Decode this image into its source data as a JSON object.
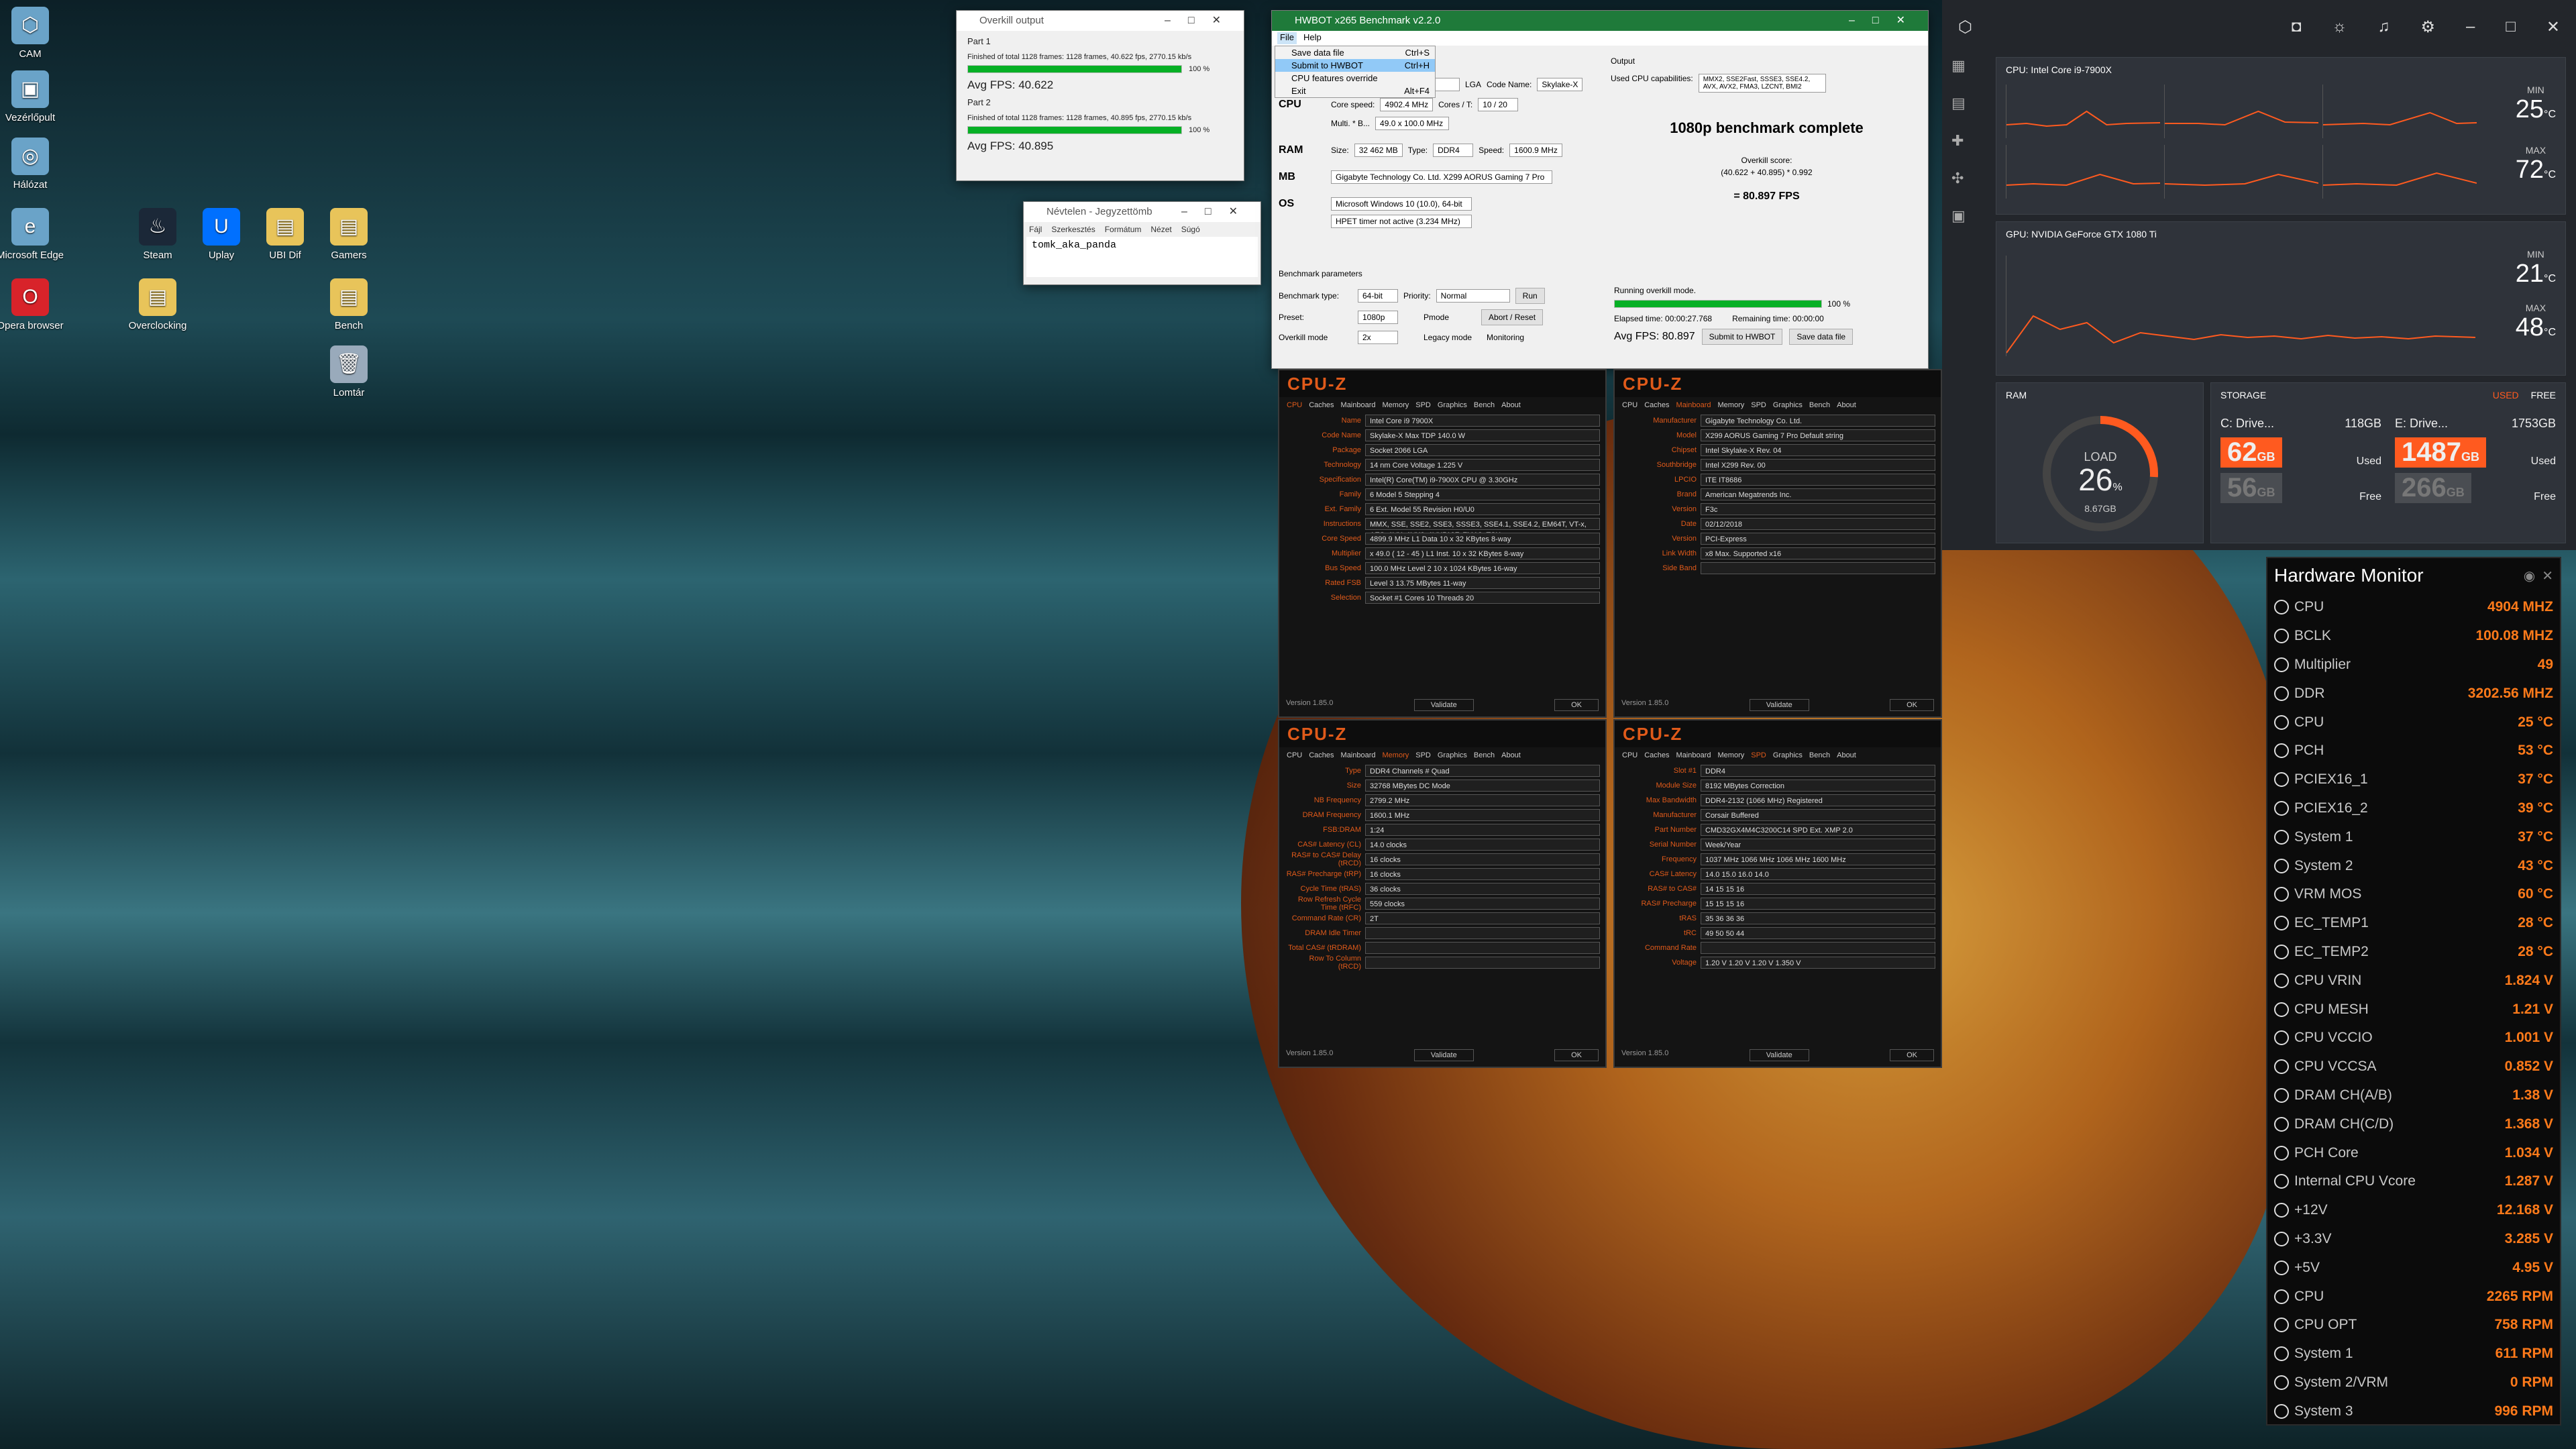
{
  "desktop": {
    "icons": [
      {
        "label": "CAM",
        "glyph": "⬡"
      },
      {
        "label": "Vezérlőpult",
        "glyph": "▣"
      },
      {
        "label": "Hálózat",
        "glyph": "◎"
      },
      {
        "label": "Microsoft Edge",
        "glyph": "e"
      },
      {
        "label": "Opera browser",
        "glyph": "O"
      },
      {
        "label": "Steam",
        "glyph": "♨"
      },
      {
        "label": "Uplay",
        "glyph": "U"
      },
      {
        "label": "UBI Dif",
        "glyph": "▤"
      },
      {
        "label": "Gamers",
        "glyph": "▤"
      },
      {
        "label": "Overclocking",
        "glyph": "▤"
      },
      {
        "label": "Bench",
        "glyph": "▤"
      },
      {
        "label": "Lomtár",
        "glyph": "🗑"
      }
    ]
  },
  "overkill": {
    "title": "Overkill output",
    "part1": "Part 1",
    "line1": "Finished of total 1128 frames: 1128 frames, 40.622 fps,  2770.15 kb/s",
    "pct1": "100 %",
    "avg1": "Avg FPS: 40.622",
    "part2": "Part 2",
    "line2": "Finished of total 1128 frames: 1128 frames, 40.895 fps,  2770.15 kb/s",
    "pct2": "100 %",
    "avg2": "Avg FPS: 40.895",
    "progress": 1.0
  },
  "notepad": {
    "title": "Névtelen - Jegyzettömb",
    "menu": [
      "Fájl",
      "Szerkesztés",
      "Formátum",
      "Nézet",
      "Súgó"
    ],
    "text": "tomk_aka_panda"
  },
  "hwbot": {
    "title": "HWBOT x265 Benchmark v2.2.0",
    "menu": [
      "File",
      "Help"
    ],
    "filemenu": [
      {
        "label": "Save data file",
        "key": "Ctrl+S"
      },
      {
        "label": "Submit to HWBOT",
        "key": "Ctrl+H"
      },
      {
        "label": "CPU features override",
        "key": ""
      },
      {
        "label": "Exit",
        "key": "Alt+F4"
      }
    ],
    "cpu_name": "e i9-7900X",
    "socket": "LGA",
    "code_name_label": "Code Name:",
    "code_name": "Skylake-X",
    "cpu_label": "CPU",
    "core_speed_label": "Core speed:",
    "core_speed": "4902.4 MHz",
    "cores_label": "Cores / T:",
    "cores": "10 / 20",
    "multi_label": "Multi. * B...",
    "multi": "49.0 x 100.0 MHz",
    "ram_label": "RAM",
    "size_label": "Size:",
    "size": "32 462 MB",
    "type_label": "Type:",
    "type": "DDR4",
    "speed_label": "Speed:",
    "speed": "1600.9 MHz",
    "mb_label": "MB",
    "mb": "Gigabyte Technology Co. Ltd. X299 AORUS Gaming 7 Pro",
    "os_label": "OS",
    "os": "Microsoft Windows 10 (10.0), 64-bit",
    "hpet": "HPET timer not active (3.234 MHz)",
    "output_label": "Output",
    "cpu_caps_label": "Used CPU capabilities:",
    "cpu_caps": "MMX2, SSE2Fast, SSSE3, SSE4.2, AVX, AVX2, FMA3, LZCNT, BMI2",
    "complete": "1080p benchmark complete",
    "score_label": "Overkill score:",
    "score_formula": "(40.622 + 40.895) * 0.992",
    "score": "= 80.897 FPS",
    "params_label": "Benchmark parameters",
    "bench_type_label": "Benchmark type:",
    "bench_type": "64-bit",
    "priority_label": "Priority:",
    "priority": "Normal",
    "run": "Run",
    "preset_label": "Preset:",
    "preset": "1080p",
    "pmode": "Pmode",
    "abort": "Abort / Reset",
    "overkill_label": "Overkill mode",
    "overkill_val": "2x",
    "legacy": "Legacy mode",
    "monitoring": "Monitoring",
    "running": "Running overkill mode.",
    "run_pct": "100 %",
    "elapsed": "Elapsed time: 00:00:27.768",
    "remaining": "Remaining time: 00:00:00",
    "avg": "Avg FPS: 80.897",
    "submit": "Submit to HWBOT",
    "save": "Save data file",
    "progress": 1.0
  },
  "cpuz": [
    {
      "active": "CPU",
      "rows": [
        [
          "Name",
          "Intel Core i9 7900X"
        ],
        [
          "Code Name",
          "Skylake-X   Max TDP 140.0 W"
        ],
        [
          "Package",
          "Socket 2066 LGA"
        ],
        [
          "Technology",
          "14 nm   Core Voltage 1.225 V"
        ],
        [
          "Specification",
          "Intel(R) Core(TM) i9-7900X CPU @ 3.30GHz"
        ],
        [
          "Family",
          "6   Model 5   Stepping 4"
        ],
        [
          "Ext. Family",
          "6   Ext. Model 55   Revision H0/U0"
        ],
        [
          "Instructions",
          "MMX, SSE, SSE2, SSE3, SSSE3, SSE4.1, SSE4.2, EM64T, VT-x, AES, AVX, AVX2, AVX512F, FMA3, TSX"
        ],
        [
          "Core Speed",
          "4899.9 MHz   L1 Data 10 x 32 KBytes 8-way"
        ],
        [
          "Multiplier",
          "x 49.0 ( 12 - 45 )   L1 Inst. 10 x 32 KBytes 8-way"
        ],
        [
          "Bus Speed",
          "100.0 MHz   Level 2 10 x 1024 KBytes 16-way"
        ],
        [
          "Rated FSB",
          "Level 3 13.75 MBytes 11-way"
        ],
        [
          "Selection",
          "Socket #1   Cores 10   Threads 20"
        ]
      ]
    },
    {
      "active": "Mainboard",
      "rows": [
        [
          "Manufacturer",
          "Gigabyte Technology Co. Ltd."
        ],
        [
          "Model",
          "X299 AORUS Gaming 7 Pro   Default string"
        ],
        [
          "Chipset",
          "Intel   Skylake-X   Rev. 04"
        ],
        [
          "Southbridge",
          "Intel   X299   Rev. 00"
        ],
        [
          "LPCIO",
          "ITE   IT8686"
        ],
        [
          "Brand",
          "American Megatrends Inc."
        ],
        [
          "Version",
          "F3c"
        ],
        [
          "Date",
          "02/12/2018"
        ],
        [
          "Version",
          "PCI-Express"
        ],
        [
          "Link Width",
          "x8   Max. Supported x16"
        ],
        [
          "Side Band",
          ""
        ]
      ]
    },
    {
      "active": "Memory",
      "rows": [
        [
          "Type",
          "DDR4   Channels # Quad"
        ],
        [
          "Size",
          "32768 MBytes   DC Mode"
        ],
        [
          "NB Frequency",
          "2799.2 MHz"
        ],
        [
          "DRAM Frequency",
          "1600.1 MHz"
        ],
        [
          "FSB:DRAM",
          "1:24"
        ],
        [
          "CAS# Latency (CL)",
          "14.0 clocks"
        ],
        [
          "RAS# to CAS# Delay (tRCD)",
          "16 clocks"
        ],
        [
          "RAS# Precharge (tRP)",
          "16 clocks"
        ],
        [
          "Cycle Time (tRAS)",
          "36 clocks"
        ],
        [
          "Row Refresh Cycle Time (tRFC)",
          "559 clocks"
        ],
        [
          "Command Rate (CR)",
          "2T"
        ],
        [
          "DRAM Idle Timer",
          ""
        ],
        [
          "Total CAS# (tRDRAM)",
          ""
        ],
        [
          "Row To Column (tRCD)",
          ""
        ]
      ]
    },
    {
      "active": "SPD",
      "rows": [
        [
          "Slot #1",
          "DDR4"
        ],
        [
          "Module Size",
          "8192 MBytes   Correction"
        ],
        [
          "Max Bandwidth",
          "DDR4-2132 (1066 MHz)   Registered"
        ],
        [
          "Manufacturer",
          "Corsair   Buffered"
        ],
        [
          "Part Number",
          "CMD32GX4M4C3200C14   SPD Ext. XMP 2.0"
        ],
        [
          "Serial Number",
          "Week/Year"
        ],
        [
          "Frequency",
          "1037 MHz  1066 MHz  1066 MHz  1600 MHz"
        ],
        [
          "CAS# Latency",
          "14.0  15.0  16.0  14.0"
        ],
        [
          "RAS# to CAS#",
          "14  15  15  16"
        ],
        [
          "RAS# Precharge",
          "15  15  15  16"
        ],
        [
          "tRAS",
          "35  36  36  36"
        ],
        [
          "tRC",
          "49  50  50  44"
        ],
        [
          "Command Rate",
          ""
        ],
        [
          "Voltage",
          "1.20 V  1.20 V  1.20 V  1.350 V"
        ]
      ]
    }
  ],
  "cpuz_common": {
    "logo": "CPU-Z",
    "tabs": [
      "CPU",
      "Caches",
      "Mainboard",
      "Memory",
      "SPD",
      "Graphics",
      "Bench",
      "About"
    ],
    "version": "Version 1.85.0",
    "validate": "Validate",
    "ok": "OK"
  },
  "occ": {
    "cpu_title": "CPU:",
    "cpu_name": "Intel Core i9-7900X",
    "min_label": "MIN",
    "min": "25",
    "max_label": "MAX",
    "max": "72",
    "unit": "°C",
    "gpu_title": "GPU:",
    "gpu_name": "NVIDIA GeForce GTX 1080 Ti",
    "gmin": "21",
    "gmax": "48",
    "ram_label": "RAM",
    "load_label": "LOAD",
    "load": "26",
    "load_unit": "%",
    "ram_used": "8.67GB",
    "load_fraction": 0.26,
    "storage_label": "STORAGE",
    "used_label": "USED",
    "free_label": "FREE",
    "drives": [
      {
        "name": "C: Drive...",
        "total": "118GB",
        "used": "62",
        "used_unit": "GB",
        "free": "56",
        "free_unit": "GB"
      },
      {
        "name": "E: Drive...",
        "total": "1753GB",
        "used": "1487",
        "used_unit": "GB",
        "free": "266",
        "free_unit": "GB"
      }
    ],
    "used": "Used",
    "free": "Free",
    "accent": "#ff5a1f"
  },
  "hwmon": {
    "title": "Hardware Monitor",
    "rows": [
      [
        "CPU",
        "4904 MHZ"
      ],
      [
        "BCLK",
        "100.08 MHZ"
      ],
      [
        "Multiplier",
        "49"
      ],
      [
        "DDR",
        "3202.56 MHZ"
      ],
      [
        "CPU",
        "25 °C"
      ],
      [
        "PCH",
        "53 °C"
      ],
      [
        "PCIEX16_1",
        "37 °C"
      ],
      [
        "PCIEX16_2",
        "39 °C"
      ],
      [
        "System 1",
        "37 °C"
      ],
      [
        "System 2",
        "43 °C"
      ],
      [
        "VRM MOS",
        "60 °C"
      ],
      [
        "EC_TEMP1",
        "28 °C"
      ],
      [
        "EC_TEMP2",
        "28 °C"
      ],
      [
        "CPU VRIN",
        "1.824 V"
      ],
      [
        "CPU MESH",
        "1.21 V"
      ],
      [
        "CPU VCCIO",
        "1.001 V"
      ],
      [
        "CPU VCCSA",
        "0.852 V"
      ],
      [
        "DRAM CH(A/B)",
        "1.38 V"
      ],
      [
        "DRAM CH(C/D)",
        "1.368 V"
      ],
      [
        "PCH Core",
        "1.034 V"
      ],
      [
        "Internal CPU Vcore",
        "1.287 V"
      ],
      [
        "+12V",
        "12.168 V"
      ],
      [
        "+3.3V",
        "3.285 V"
      ],
      [
        "+5V",
        "4.95 V"
      ],
      [
        "CPU",
        "2265 RPM"
      ],
      [
        "CPU OPT",
        "758 RPM"
      ],
      [
        "System 1",
        "611 RPM"
      ],
      [
        "System 2/VRM",
        "0 RPM"
      ],
      [
        "System 3",
        "996 RPM"
      ]
    ]
  }
}
